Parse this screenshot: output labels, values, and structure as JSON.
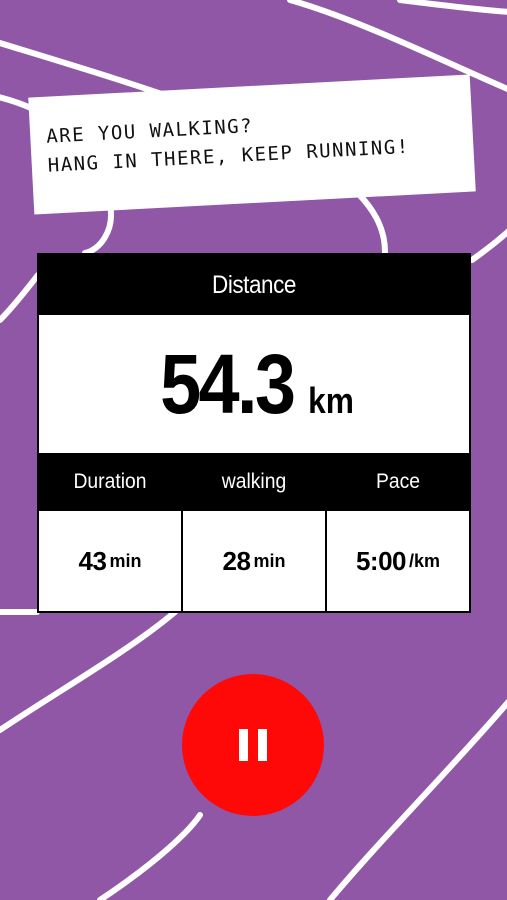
{
  "note": {
    "line1": "ARE YOU WALKING?",
    "line2": "HANG IN THERE, KEEP RUNNING!"
  },
  "distance": {
    "header": "Distance",
    "value": "54.3",
    "unit": "km"
  },
  "metrics": [
    {
      "label": "Duration",
      "value": "43",
      "unit": "min"
    },
    {
      "label": "walking",
      "value": "28",
      "unit": "min"
    },
    {
      "label": "Pace",
      "value": "5:00",
      "unit": "/km"
    }
  ],
  "controls": {
    "pause_icon": "pause-icon"
  },
  "colors": {
    "background": "#8f57a6",
    "pause_button": "#ff0808",
    "track_lines": "#ffffff"
  }
}
